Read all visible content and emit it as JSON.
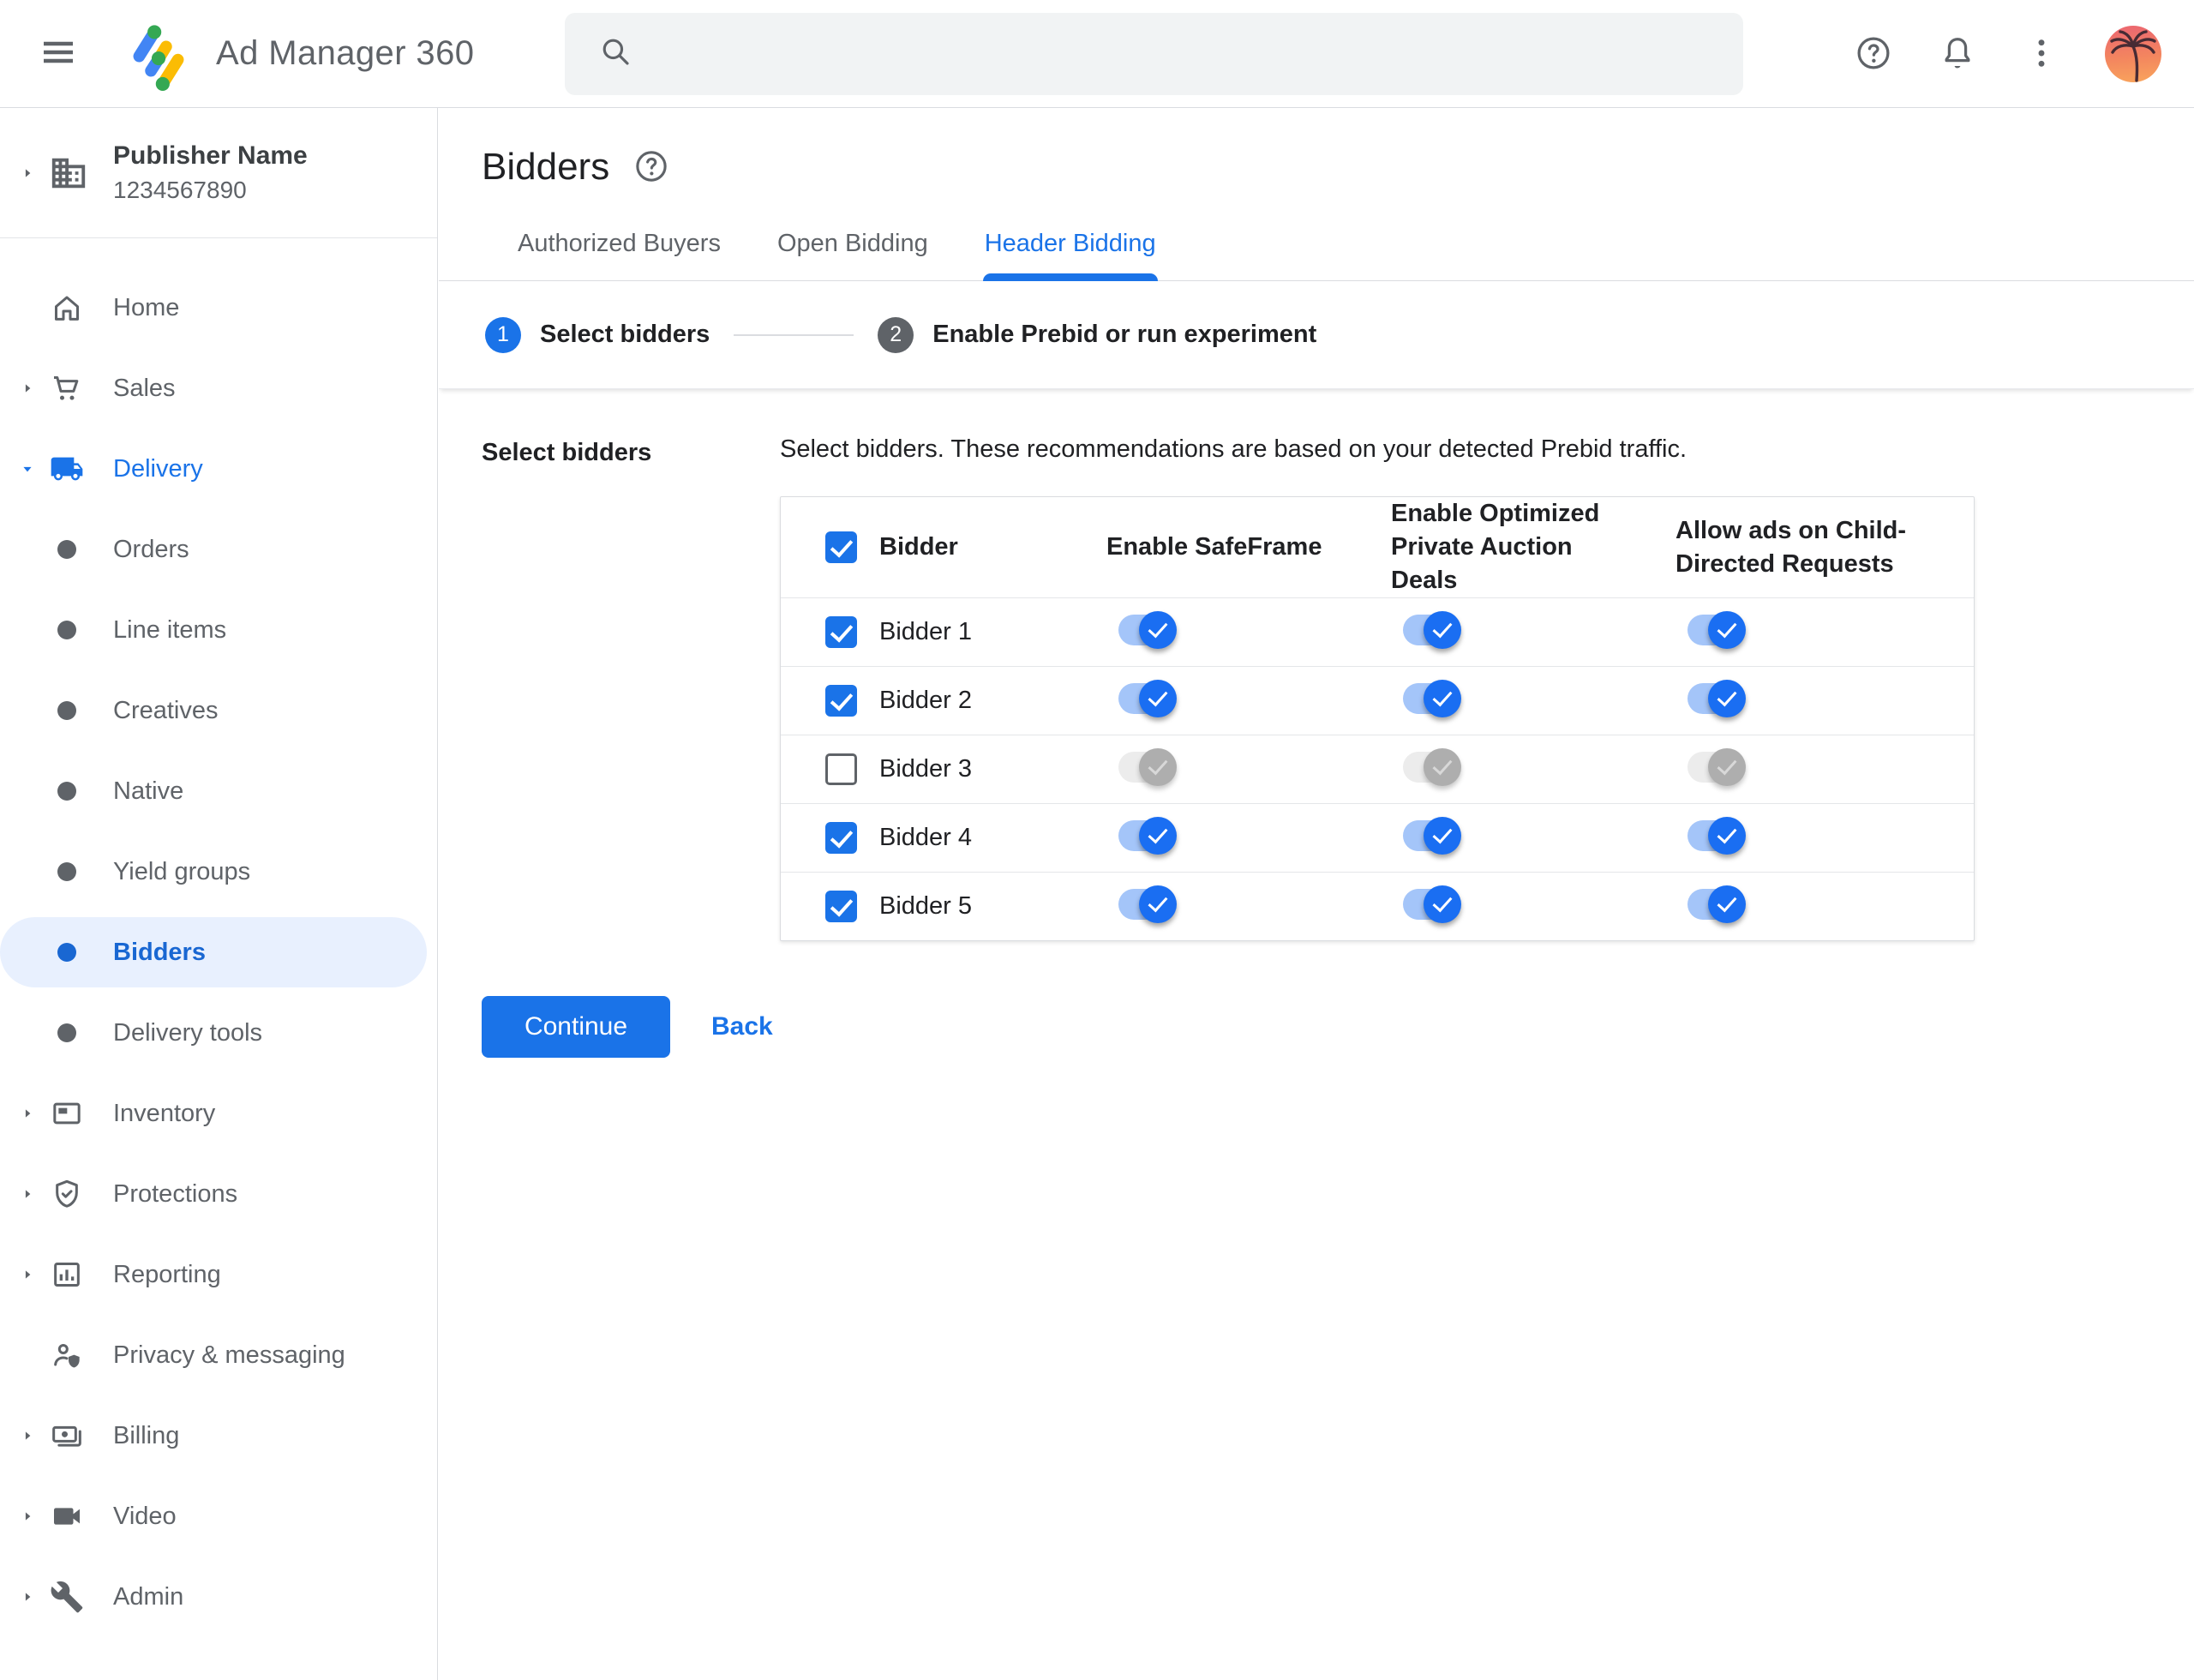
{
  "topbar": {
    "app_title": "Ad Manager 360",
    "search_placeholder": "",
    "icons": {
      "menu": "menu-icon",
      "logo": "ad-manager-logo",
      "search": "search-icon",
      "help": "help-icon",
      "notifications": "bell-icon",
      "overflow": "more-vert-icon",
      "avatar": "palm-tree-avatar"
    }
  },
  "sidebar": {
    "publisher": {
      "name": "Publisher Name",
      "id": "1234567890"
    },
    "items": [
      {
        "label": "Home",
        "icon": "home-icon",
        "arrow": null,
        "type": "top"
      },
      {
        "label": "Sales",
        "icon": "cart-icon",
        "arrow": "right",
        "type": "top"
      },
      {
        "label": "Delivery",
        "icon": "truck-icon",
        "arrow": "down",
        "type": "top",
        "expanded": true
      },
      {
        "label": "Orders",
        "type": "sub"
      },
      {
        "label": "Line items",
        "type": "sub"
      },
      {
        "label": "Creatives",
        "type": "sub"
      },
      {
        "label": "Native",
        "type": "sub"
      },
      {
        "label": "Yield groups",
        "type": "sub"
      },
      {
        "label": "Bidders",
        "type": "sub",
        "selected": true
      },
      {
        "label": "Delivery tools",
        "type": "sub"
      },
      {
        "label": "Inventory",
        "icon": "inventory-icon",
        "arrow": "right",
        "type": "top"
      },
      {
        "label": "Protections",
        "icon": "shield-check-icon",
        "arrow": "right",
        "type": "top"
      },
      {
        "label": "Reporting",
        "icon": "bar-chart-icon",
        "arrow": "right",
        "type": "top"
      },
      {
        "label": "Privacy & messaging",
        "icon": "person-shield-icon",
        "arrow": null,
        "type": "top"
      },
      {
        "label": "Billing",
        "icon": "payments-icon",
        "arrow": "right",
        "type": "top"
      },
      {
        "label": "Video",
        "icon": "videocam-icon",
        "arrow": "right",
        "type": "top"
      },
      {
        "label": "Admin",
        "icon": "wrench-icon",
        "arrow": "right",
        "type": "top"
      }
    ]
  },
  "page": {
    "title": "Bidders",
    "title_help_icon": "help-icon",
    "tabs": [
      {
        "label": "Authorized Buyers",
        "active": false
      },
      {
        "label": "Open Bidding",
        "active": false
      },
      {
        "label": "Header Bidding",
        "active": true
      }
    ],
    "stepper": [
      {
        "number": "1",
        "label": "Select bidders",
        "state": "active"
      },
      {
        "number": "2",
        "label": "Enable Prebid or run experiment",
        "state": "upcoming"
      }
    ],
    "section_label": "Select bidders",
    "description": "Select bidders. These recommendations are based on your detected Prebid traffic.",
    "table": {
      "select_all_checked": true,
      "columns": [
        "Bidder",
        "Enable SafeFrame",
        "Enable Optimized Private Auction Deals",
        "Allow ads on Child-Directed Requests"
      ],
      "rows": [
        {
          "name": "Bidder 1",
          "selected": true,
          "disabled": false,
          "safeframe": true,
          "optimized": true,
          "child_directed": true
        },
        {
          "name": "Bidder 2",
          "selected": true,
          "disabled": false,
          "safeframe": true,
          "optimized": true,
          "child_directed": true
        },
        {
          "name": "Bidder 3",
          "selected": false,
          "disabled": true,
          "safeframe": true,
          "optimized": true,
          "child_directed": true
        },
        {
          "name": "Bidder 4",
          "selected": true,
          "disabled": false,
          "safeframe": true,
          "optimized": true,
          "child_directed": true
        },
        {
          "name": "Bidder 5",
          "selected": true,
          "disabled": false,
          "safeframe": true,
          "optimized": true,
          "child_directed": true
        }
      ]
    },
    "continue_label": "Continue",
    "back_label": "Back"
  },
  "colors": {
    "accent": "#1a73e8",
    "active_nav_text": "#1967d2",
    "nav_selected_bg": "#e8f0fe",
    "toggle_track_on": "#a4c5f9",
    "toggle_thumb_on": "#1a6ef2",
    "toggle_track_disabled": "#ececec",
    "toggle_thumb_disabled": "#aeaeae",
    "step_upcoming": "#5f6368",
    "border": "#dadce0",
    "text_primary": "#202124",
    "text_secondary": "#5f6368",
    "search_bg": "#f1f3f4",
    "logo_blue": "#4285f4",
    "logo_yellow": "#fbbc04",
    "logo_green": "#34a853"
  }
}
